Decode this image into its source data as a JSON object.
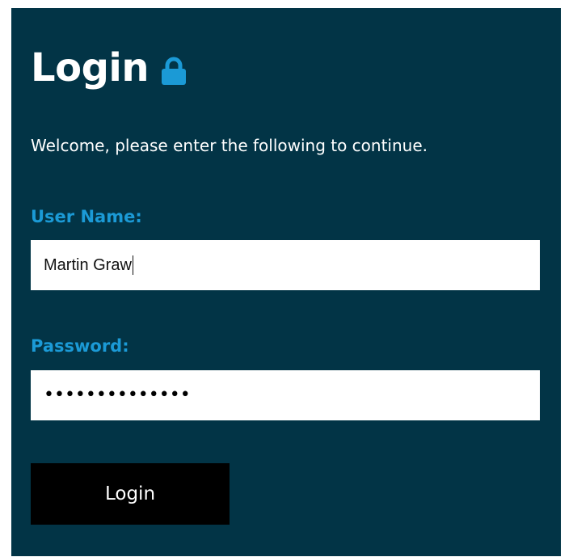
{
  "login": {
    "title": "Login",
    "lock_icon": "lock-icon",
    "welcome_text": "Welcome, please enter the following to continue.",
    "username_label": "User Name:",
    "username_value": "Martin Graw",
    "password_label": "Password:",
    "password_masked": "••••••••••••••",
    "button_label": "Login"
  },
  "colors": {
    "panel_background": "#023446",
    "label_accent": "#1b9ad6",
    "button_background": "#000000",
    "input_background": "#ffffff"
  }
}
